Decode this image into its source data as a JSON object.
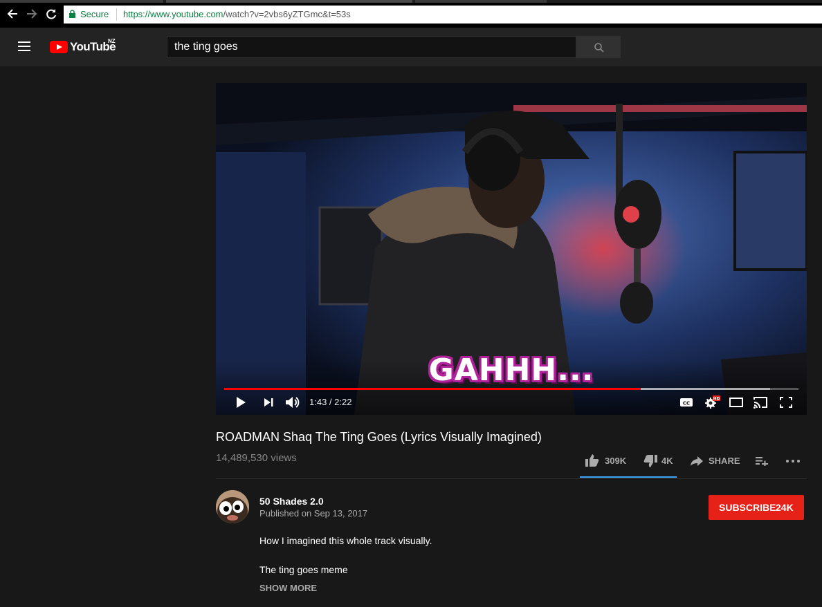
{
  "browser": {
    "secure_label": "Secure",
    "url_prefix": "https://www.youtube.com",
    "url_path": "/watch?v=2vbs6yZTGmc&t=53s"
  },
  "masthead": {
    "logo_text": "YouTube",
    "country_code": "NZ",
    "search_value": "the ting goes"
  },
  "player": {
    "overlay_caption": "GAHHH...",
    "current_time": "1:43",
    "duration": "2:22",
    "time_display": "1:43 / 2:22",
    "progress_fraction": 0.7254,
    "buffered_fraction": 0.95,
    "hd_badge": "HD",
    "cc_label": "CC"
  },
  "video": {
    "title": "ROADMAN Shaq The Ting Goes (Lyrics Visually Imagined)",
    "views": "14,489,530 views",
    "likes": "309K",
    "dislikes": "4K",
    "share_label": "SHARE",
    "like_ratio": 0.987
  },
  "channel": {
    "name": "50 Shades 2.0",
    "published": "Published on Sep 13, 2017",
    "subscribe_label": "SUBSCRIBE",
    "subscriber_count": "24K"
  },
  "description": {
    "line1": "How I imagined this whole track visually.",
    "line2": "The ting goes meme",
    "show_more": "SHOW MORE"
  },
  "colors": {
    "accent_red": "#ff0000",
    "subscribe_red": "#e62117",
    "like_bar_blue": "#3ea6ff",
    "caption_magenta": "#b0229b"
  }
}
